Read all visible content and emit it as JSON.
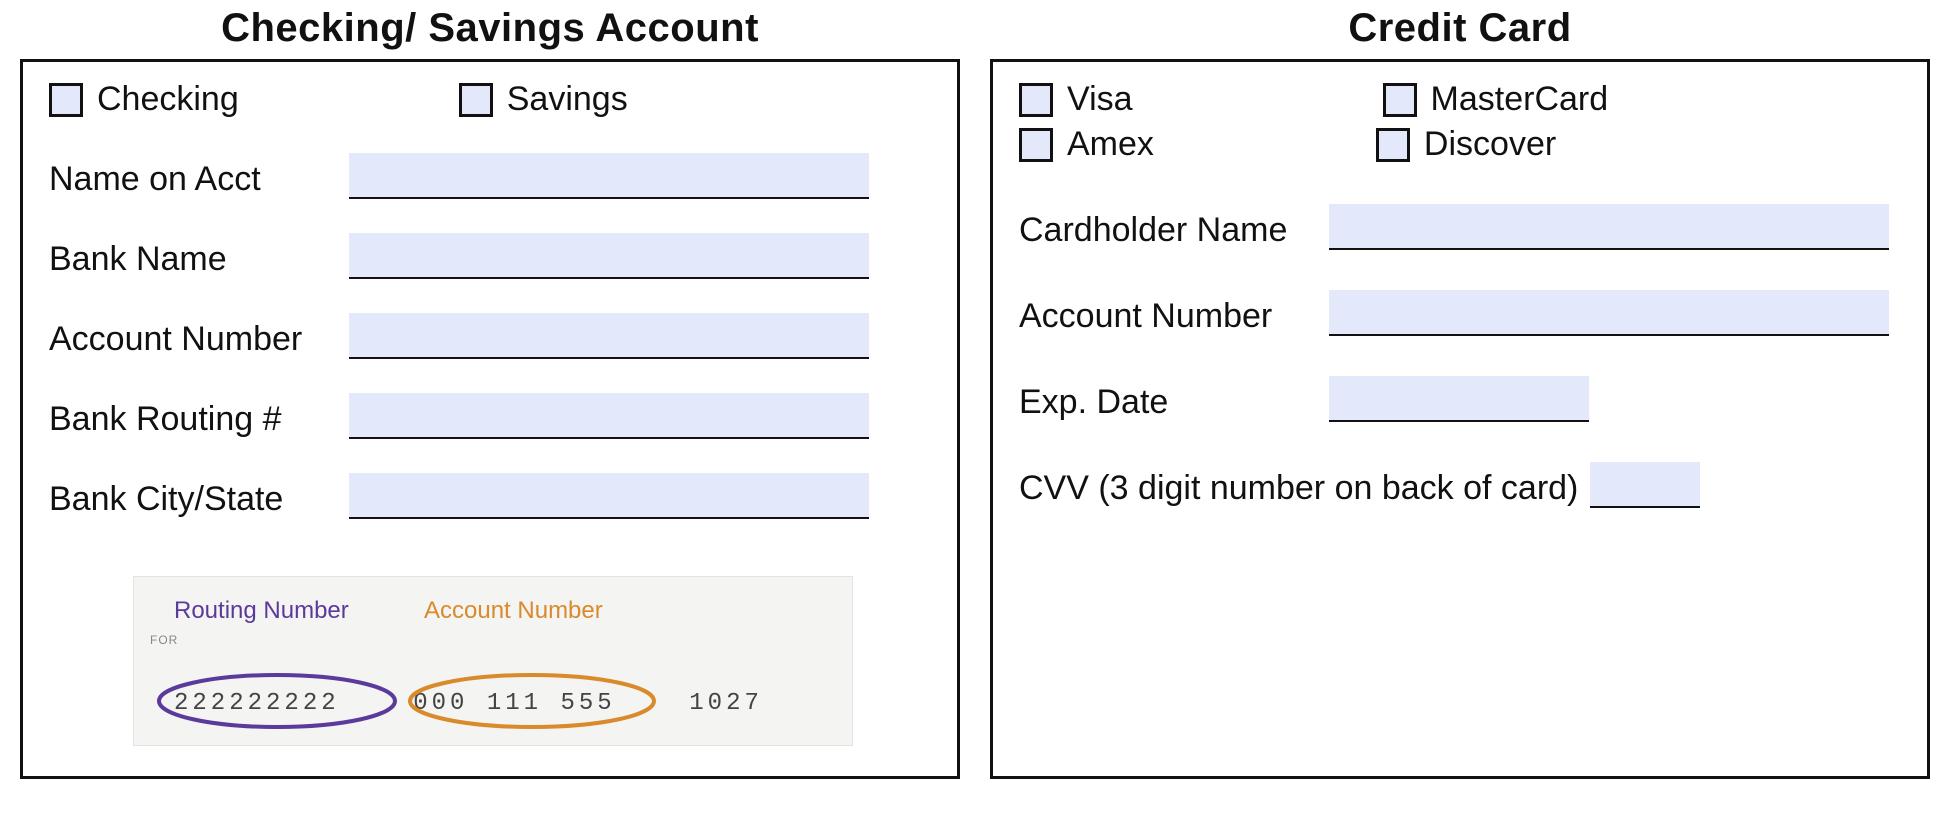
{
  "left": {
    "title": "Checking/ Savings Account",
    "checks": {
      "checking": "Checking",
      "savings": "Savings"
    },
    "fields": {
      "name_on_acct": {
        "label": "Name on Acct",
        "value": ""
      },
      "bank_name": {
        "label": "Bank Name",
        "value": ""
      },
      "account_number": {
        "label": "Account Number",
        "value": ""
      },
      "bank_routing": {
        "label": "Bank Routing #",
        "value": ""
      },
      "bank_city_state": {
        "label": "Bank City/State",
        "value": ""
      }
    },
    "sample_check": {
      "routing_label": "Routing Number",
      "account_label": "Account Number",
      "for_label": "FOR",
      "routing_digits": "222222222",
      "account_digits": "000 111 555",
      "check_number": "1027"
    }
  },
  "right": {
    "title": "Credit Card",
    "checks": {
      "visa": "Visa",
      "mastercard": "MasterCard",
      "amex": "Amex",
      "discover": "Discover"
    },
    "fields": {
      "cardholder_name": {
        "label": "Cardholder Name",
        "value": ""
      },
      "account_number": {
        "label": "Account Number",
        "value": ""
      },
      "exp_date": {
        "label": "Exp. Date",
        "value": ""
      },
      "cvv": {
        "label": "CVV (3 digit number on back of card)",
        "value": ""
      }
    }
  }
}
